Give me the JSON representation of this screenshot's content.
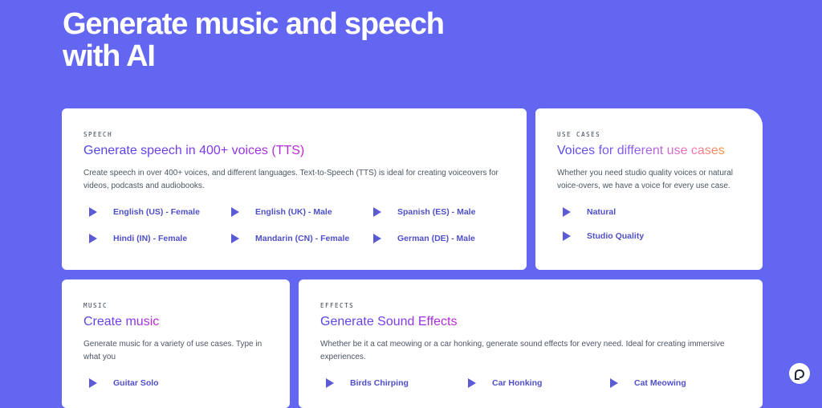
{
  "hero": {
    "title": "Generate music and speech with AI"
  },
  "speech": {
    "eyebrow": "SPEECH",
    "title": "Generate speech in 400+ voices (TTS)",
    "description": "Create speech in over 400+ voices, and different languages. Text-to-Speech (TTS) is ideal for creating voiceovers for videos, podcasts and audiobooks.",
    "options": [
      "English (US) - Female",
      "English (UK) - Male",
      "Spanish (ES) - Male",
      "Hindi (IN) - Female",
      "Mandarin (CN) - Female",
      "German (DE) - Male"
    ]
  },
  "use_cases": {
    "eyebrow": "USE CASES",
    "title": "Voices for different use cases",
    "description": "Whether you need studio quality voices or natural voice-overs, we have a voice for every use case.",
    "options": [
      "Natural",
      "Studio Quality"
    ]
  },
  "music": {
    "eyebrow": "MUSIC",
    "title": "Create music",
    "description": "Generate music for a variety of use cases. Type in what you",
    "options": [
      "Guitar Solo"
    ]
  },
  "effects": {
    "eyebrow": "EFFECTS",
    "title": "Generate Sound Effects",
    "description": "Whether be it a cat meowing or a car honking, generate sound effects for every need. Ideal for creating immersive experiences.",
    "options": [
      "Birds Chirping",
      "Car Honking",
      "Cat Meowing"
    ]
  },
  "colors": {
    "background": "#6366f1",
    "accent": "#4f4fc8",
    "play_icon": "#5b5bd6"
  },
  "icons": {
    "play": "play-icon",
    "chat": "chat-icon"
  }
}
